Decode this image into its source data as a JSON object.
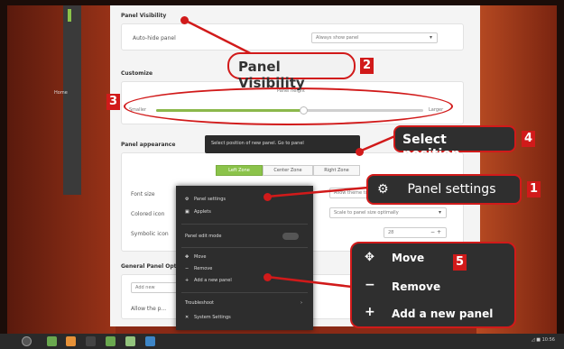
{
  "desktop": {
    "home_label": "Home"
  },
  "dialog": {
    "visibility_heading": "Panel Visibility",
    "autohide_label": "Auto-hide panel",
    "autohide_value": "Always show panel",
    "customize_heading": "Customize",
    "panel_height_label": "Panel height",
    "slider_min": "Smaller",
    "slider_max": "Larger",
    "slider_value": 0.55,
    "appearance_heading": "Panel appearance",
    "font_size_label": "Font size",
    "font_size_value": "Allow theme to ...",
    "colored_icon_label": "Colored icon",
    "colored_icon_value": "Scale to panel size optimally",
    "symbolic_label": "Symbolic icon",
    "symbolic_value": "28",
    "general_heading": "General Panel Options",
    "add_new_label": "Add new",
    "allow_label": "Allow the p...",
    "zones": [
      "Left Zone",
      "Center Zone",
      "Right Zone"
    ],
    "active_zone": "Left Zone"
  },
  "tooltip": {
    "text": "Select position of new panel. Go to panel"
  },
  "context_menu": {
    "top_items": [
      {
        "icon": "gear-icon",
        "glyph": "⚙",
        "label": "Panel settings"
      },
      {
        "icon": "applets-icon",
        "glyph": "▣",
        "label": "Applets"
      }
    ],
    "edit_mode_label": "Panel edit mode",
    "mid_items": [
      {
        "icon": "move-icon",
        "glyph": "✥",
        "label": "Move"
      },
      {
        "icon": "minus-icon",
        "glyph": "−",
        "label": "Remove"
      },
      {
        "icon": "plus-icon",
        "glyph": "+",
        "label": "Add a new panel"
      }
    ],
    "troubleshoot_label": "Troubleshoot",
    "system_settings_label": "System Settings"
  },
  "callouts": {
    "visibility": {
      "text": "Panel Visibility",
      "number": "2"
    },
    "slider": {
      "number": "3"
    },
    "position": {
      "text": "Select position",
      "number": "4"
    },
    "settings": {
      "icon": "gear-icon",
      "glyph": "⚙",
      "text": "Panel settings",
      "number": "1"
    },
    "menu": {
      "number": "5",
      "items": [
        {
          "icon": "move-icon",
          "glyph": "✥",
          "label": "Move"
        },
        {
          "icon": "minus-icon",
          "glyph": "−",
          "label": "Remove"
        },
        {
          "icon": "plus-icon",
          "glyph": "+",
          "label": "Add a new panel"
        }
      ]
    }
  },
  "taskbar": {
    "tray_text": "◿ ■ 10:56"
  },
  "colors": {
    "accent": "#8bc34a",
    "callout_red": "#d11a1a",
    "desktop": "#8a2a16"
  }
}
